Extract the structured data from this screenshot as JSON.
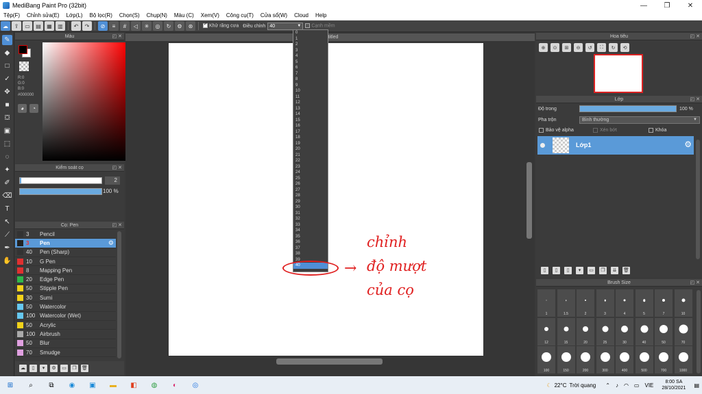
{
  "window": {
    "title": "MediBang Paint Pro (32bit)",
    "controls": {
      "minimize": "—",
      "maximize": "❐",
      "close": "✕"
    }
  },
  "menu": [
    "Tệp(F)",
    "Chỉnh sửa(E)",
    "Lớp(L)",
    "Bộ lọc(R)",
    "Chọn(S)",
    "Chụp(N)",
    "Màu (C)",
    "Xem(V)",
    "Công cụ(T)",
    "Cửa sổ(W)",
    "Cloud",
    "Help"
  ],
  "toolbar": {
    "antialias_label": "Khử răng cưa",
    "stabilizer_label": "Điều chỉnh",
    "stabilizer_value": "40",
    "sharp_edge_label": "Cạnh mềm"
  },
  "stabilizer_options": [
    "0",
    "1",
    "2",
    "3",
    "4",
    "5",
    "6",
    "7",
    "8",
    "9",
    "10",
    "11",
    "12",
    "13",
    "14",
    "15",
    "16",
    "17",
    "18",
    "19",
    "20",
    "21",
    "22",
    "23",
    "24",
    "25",
    "26",
    "27",
    "28",
    "29",
    "30",
    "31",
    "32",
    "33",
    "34",
    "35",
    "36",
    "37",
    "38",
    "39",
    "40"
  ],
  "stabilizer_selected_index": 40,
  "color_panel": {
    "title": "Màu",
    "r": "R:0",
    "g": "G:0",
    "b": "B:0",
    "hex": "#000000",
    "colors": {
      "foreground": "#000000",
      "background": "#ffffff"
    }
  },
  "brush_control": {
    "title": "Kiểm soát cọ",
    "size": "2",
    "opacity": "100 %",
    "size_fraction": 0.02,
    "opacity_fraction": 1.0
  },
  "brush_panel": {
    "title": "Cọ: Pen",
    "items": [
      {
        "size": "3",
        "name": "Pencil",
        "color": "#333333"
      },
      {
        "size": "3",
        "name": "Pen",
        "color": "#222222",
        "selected": true
      },
      {
        "size": "40",
        "name": "Pen (Sharp)",
        "color": "#333333"
      },
      {
        "size": "10",
        "name": "G Pen",
        "color": "#e03030"
      },
      {
        "size": "8",
        "name": "Mapping Pen",
        "color": "#e03030"
      },
      {
        "size": "20",
        "name": "Edge Pen",
        "color": "#2fb84a"
      },
      {
        "size": "50",
        "name": "Stipple Pen",
        "color": "#f2d21a"
      },
      {
        "size": "30",
        "name": "Sumi",
        "color": "#f2d21a"
      },
      {
        "size": "50",
        "name": "Watercolor",
        "color": "#66c8f0"
      },
      {
        "size": "100",
        "name": "Watercolor (Wet)",
        "color": "#66c8f0"
      },
      {
        "size": "50",
        "name": "Acrylic",
        "color": "#f2d21a"
      },
      {
        "size": "100",
        "name": "Airbrush",
        "color": "#aaaaaa"
      },
      {
        "size": "50",
        "name": "Blur",
        "color": "#e0a0e0"
      },
      {
        "size": "70",
        "name": "Smudge",
        "color": "#e0a0e0"
      }
    ]
  },
  "canvas": {
    "tab_title": "Untitled"
  },
  "annotation": {
    "arrow": "→",
    "line1": "chỉnh",
    "line2": "độ mượt",
    "line3": "của cọ",
    "color": "#e02020"
  },
  "navigator": {
    "title": "Hoa tiêu"
  },
  "layer_panel": {
    "title": "Lớp",
    "opacity_label": "Độ trong",
    "opacity_value": "100 %",
    "blend_label": "Pha trộn",
    "blend_value": "Bình thường",
    "protect_alpha": "Bảo vệ alpha",
    "clipping": "Xén bớt",
    "lock": "Khóa",
    "layer_name": "Lớp1"
  },
  "brush_size_panel": {
    "title": "Brush Size",
    "sizes": [
      "1",
      "1.5",
      "2",
      "3",
      "4",
      "5",
      "7",
      "10",
      "12",
      "15",
      "20",
      "25",
      "30",
      "40",
      "50",
      "70",
      "100",
      "150",
      "200",
      "300",
      "400",
      "500",
      "700",
      "1000"
    ]
  },
  "taskbar": {
    "temperature": "22°C",
    "weather": "Trời quang",
    "language": "VIE",
    "time": "8:00 SA",
    "date": "28/10/2021"
  }
}
